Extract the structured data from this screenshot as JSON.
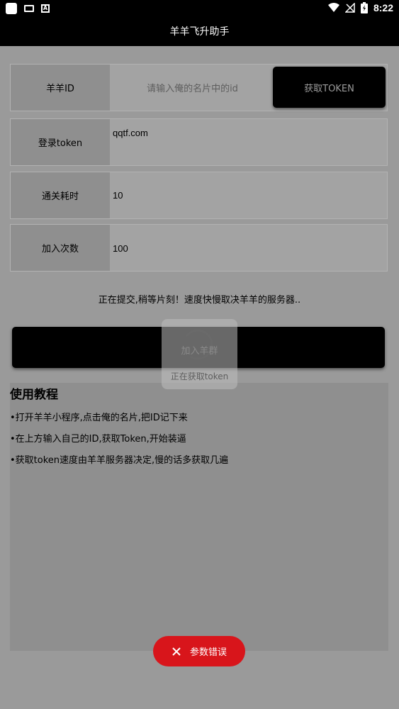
{
  "status_bar": {
    "time": "8:22"
  },
  "app_title": "羊羊飞升助手",
  "form": {
    "sheep_id": {
      "label": "羊羊ID",
      "placeholder": "请输入俺的名片中的id"
    },
    "get_token_button": "获取TOKEN",
    "login_token": {
      "label": "登录token",
      "value": "qqtf.com"
    },
    "clear_time": {
      "label": "通关耗时",
      "value": "10"
    },
    "join_count": {
      "label": "加入次数",
      "value": "100"
    }
  },
  "status_message": "正在提交,稍等片刻！速度快慢取决羊羊的服务器..",
  "join_button": "加入羊群",
  "loading_text": "正在获取token",
  "tutorial": {
    "title": "使用教程",
    "items": [
      "•打开羊羊小程序,点击俺的名片,把ID记下来",
      "•在上方输入自己的ID,获取Token,开始装逼",
      "•获取token速度由羊羊服务器决定,慢的话多获取几遍"
    ]
  },
  "toast": {
    "text": "参数错误",
    "icon": "close-icon"
  }
}
